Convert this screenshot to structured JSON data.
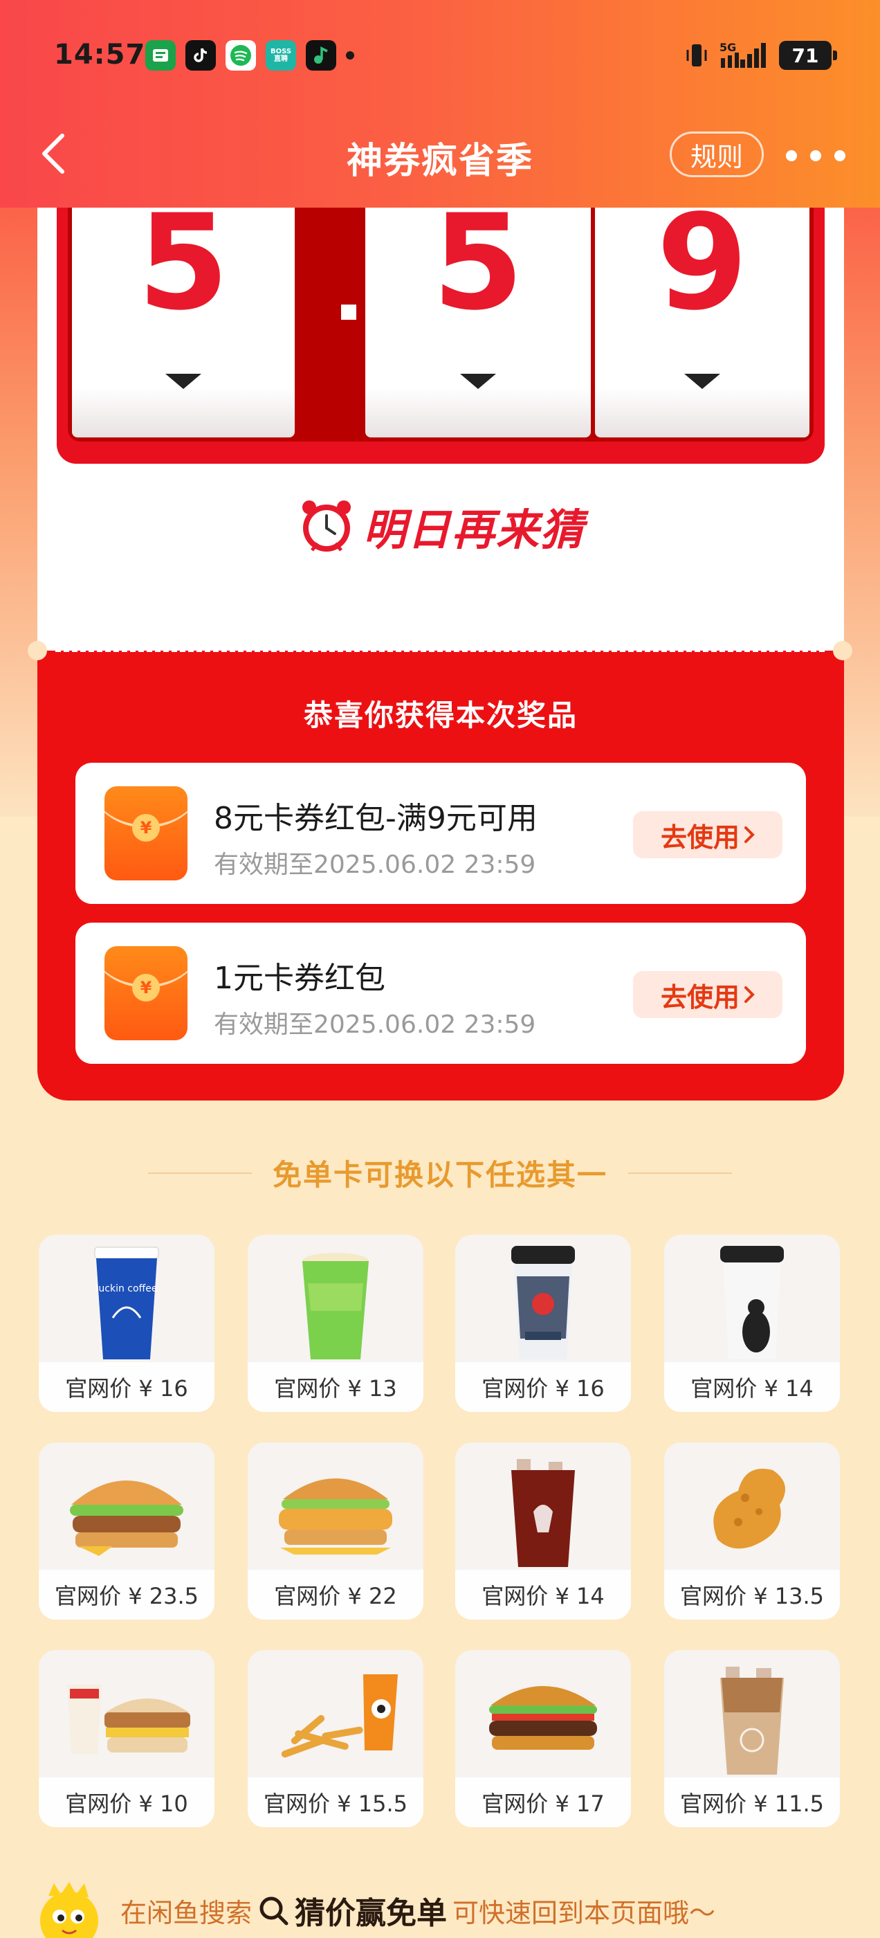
{
  "status_bar": {
    "time": "14:57",
    "battery": "71",
    "network": "5G",
    "app_icons": [
      "green-app-icon",
      "tiktok-icon",
      "music-app-icon",
      "boss-zhipin-icon",
      "qq-music-icon"
    ],
    "boss_label": "BOSS\n直聘"
  },
  "navbar": {
    "title": "神券疯省季",
    "rules_label": "规则"
  },
  "guess": {
    "digits": [
      "5",
      "5",
      "9"
    ],
    "retry_text": "明日再来猜"
  },
  "prize": {
    "title": "恭喜你获得本次奖品",
    "coupons": [
      {
        "title": "8元卡券红包-满9元可用",
        "validity": "有效期至2025.06.02 23:59",
        "button": "去使用"
      },
      {
        "title": "1元卡券红包",
        "validity": "有效期至2025.06.02 23:59",
        "button": "去使用"
      }
    ]
  },
  "free_card": {
    "title": "免单卡可换以下任选其一",
    "items": [
      {
        "price": "官网价 ¥ 16",
        "icon": "luckin-coffee-cup"
      },
      {
        "price": "官网价 ¥ 13",
        "icon": "green-drink-cup"
      },
      {
        "price": "官网价 ¥ 16",
        "icon": "chagee-tea-cup"
      },
      {
        "price": "官网价 ¥ 14",
        "icon": "white-tea-cup"
      },
      {
        "price": "官网价 ¥ 23.5",
        "icon": "chicken-burger"
      },
      {
        "price": "官网价 ¥ 22",
        "icon": "crispy-chicken-burger"
      },
      {
        "price": "官网价 ¥ 14",
        "icon": "iced-americano"
      },
      {
        "price": "官网价 ¥ 13.5",
        "icon": "fried-chicken"
      },
      {
        "price": "官网价 ¥ 10",
        "icon": "breakfast-set"
      },
      {
        "price": "官网价 ¥ 15.5",
        "icon": "chicken-fries"
      },
      {
        "price": "官网价 ¥ 17",
        "icon": "whopper-burger"
      },
      {
        "price": "官网价 ¥ 11.5",
        "icon": "iced-latte"
      }
    ]
  },
  "bottom_hint": {
    "prefix": "在闲鱼搜索",
    "keyword": "猜价赢免单",
    "suffix": "可快速回到本页面哦～"
  },
  "colors": {
    "accent_red": "#e8192c",
    "prize_red": "#ec1013",
    "gold": "#e89a2e",
    "page_bg": "#fde9c4"
  }
}
